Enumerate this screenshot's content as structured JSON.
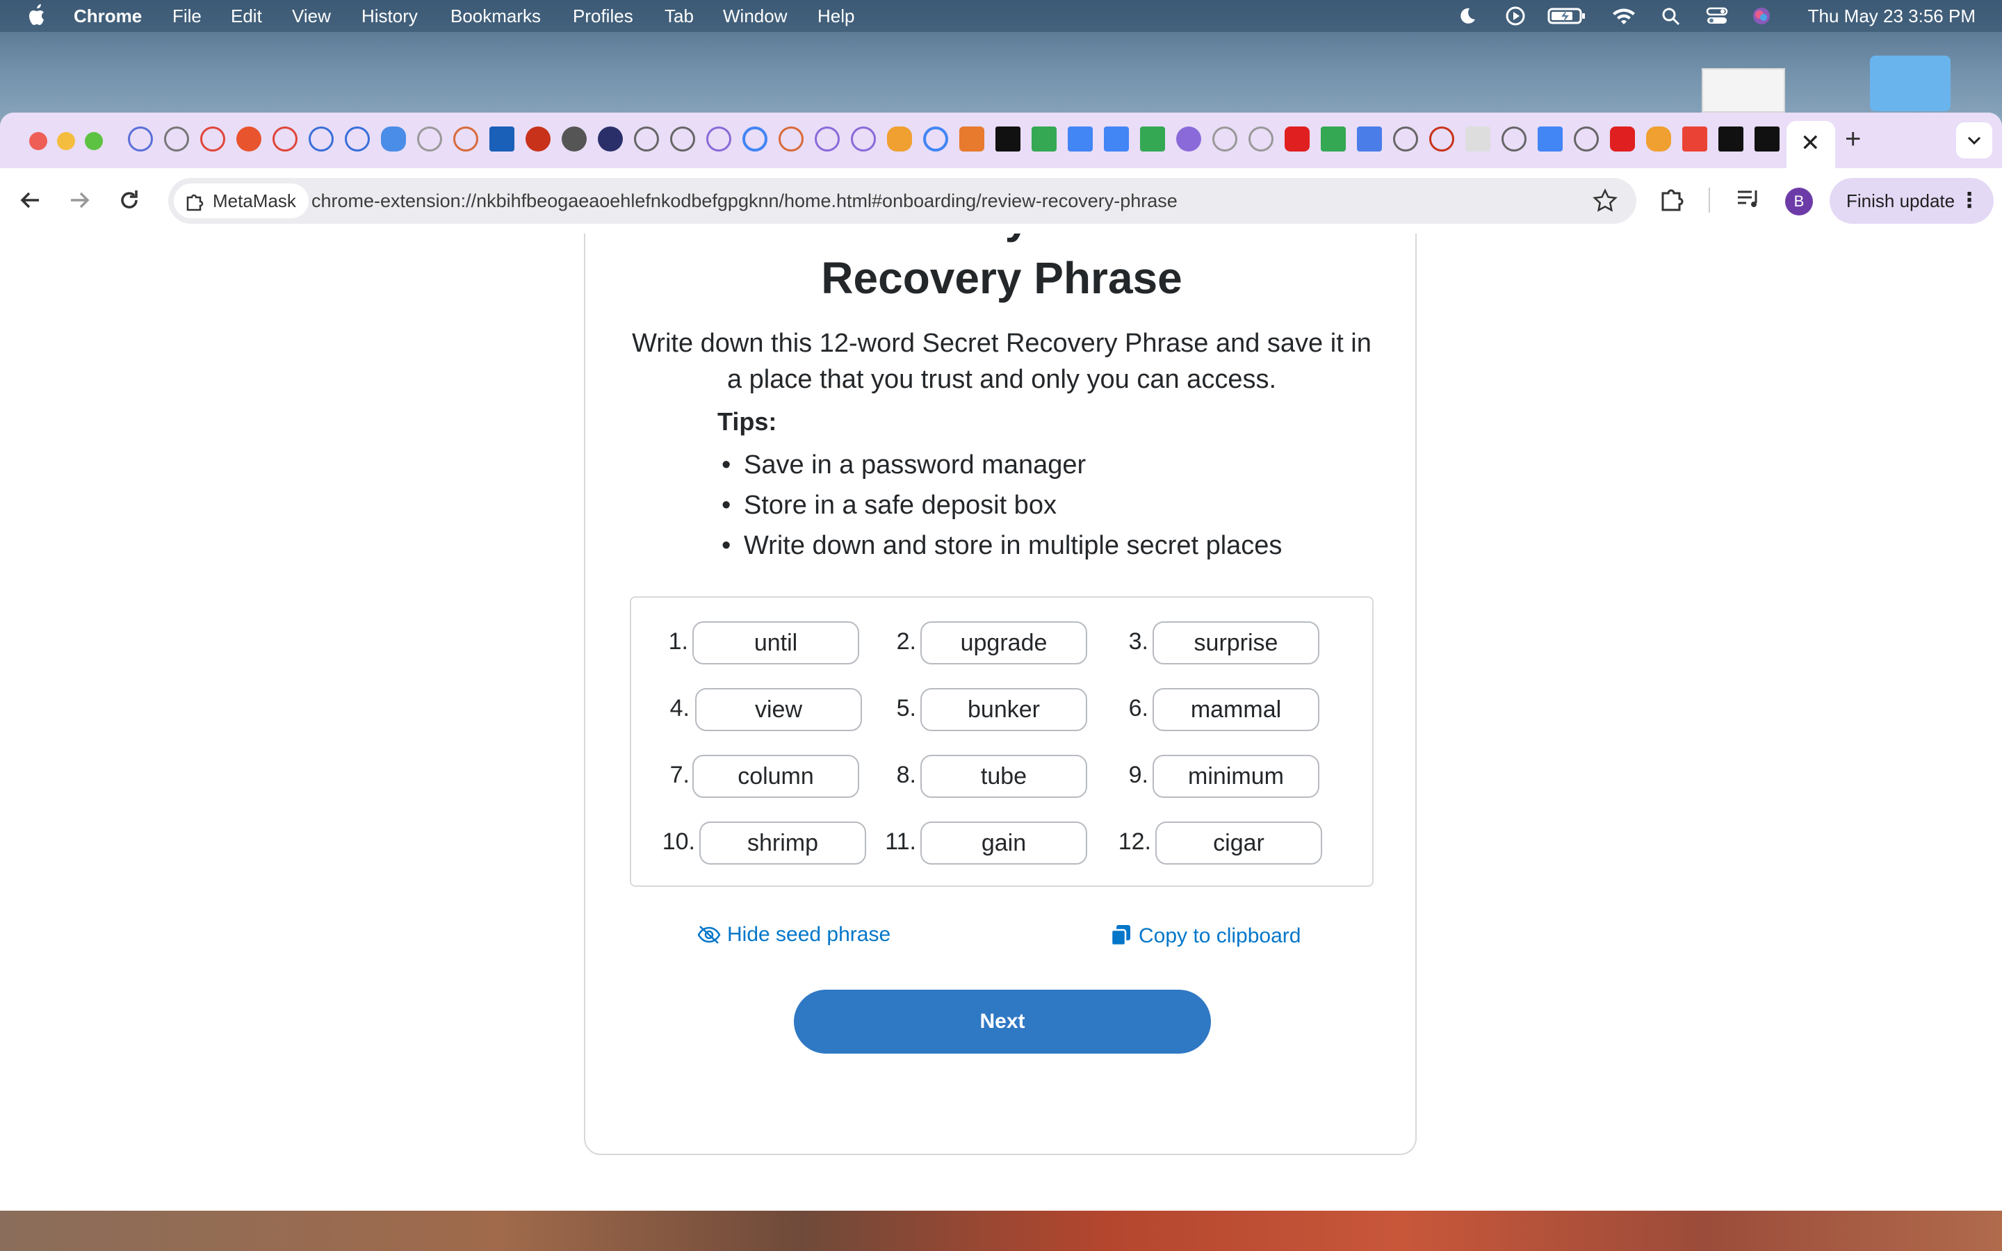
{
  "menubar": {
    "app": "Chrome",
    "items": [
      "File",
      "Edit",
      "View",
      "History",
      "Bookmarks",
      "Profiles",
      "Tab",
      "Window",
      "Help"
    ],
    "clock": "Thu May 23  3:56 PM"
  },
  "browser": {
    "active_tab_close": "✕",
    "new_tab": "+",
    "site_chip": "MetaMask",
    "url": "chrome-extension://nkbihfbeogaeaoehlefnkodbefgpgknn/home.html#onboarding/review-recovery-phrase",
    "profile_initial": "B",
    "finish_update": "Finish update"
  },
  "page": {
    "title_line1": "Write down your Secret",
    "title": "Recovery Phrase",
    "description": "Write down this 12-word Secret Recovery Phrase and save it in a place that you trust and only you can access.",
    "tips_title": "Tips:",
    "tips": [
      "Save in a password manager",
      "Store in a safe deposit box",
      "Write down and store in multiple secret places"
    ],
    "words": [
      {
        "num": "1.",
        "word": "until"
      },
      {
        "num": "2.",
        "word": "upgrade"
      },
      {
        "num": "3.",
        "word": "surprise"
      },
      {
        "num": "4.",
        "word": "view"
      },
      {
        "num": "5.",
        "word": "bunker"
      },
      {
        "num": "6.",
        "word": "mammal"
      },
      {
        "num": "7.",
        "word": "column"
      },
      {
        "num": "8.",
        "word": "tube"
      },
      {
        "num": "9.",
        "word": "minimum"
      },
      {
        "num": "10.",
        "word": "shrimp"
      },
      {
        "num": "11.",
        "word": "gain"
      },
      {
        "num": "12.",
        "word": "cigar"
      }
    ],
    "hide_seed": "Hide seed phrase",
    "copy_clipboard": "Copy to clipboard",
    "next": "Next"
  },
  "colors": {
    "accent": "#2f78c4",
    "link": "#0376c9",
    "text": "#24272a",
    "tabstrip": "#e9ddf7"
  }
}
